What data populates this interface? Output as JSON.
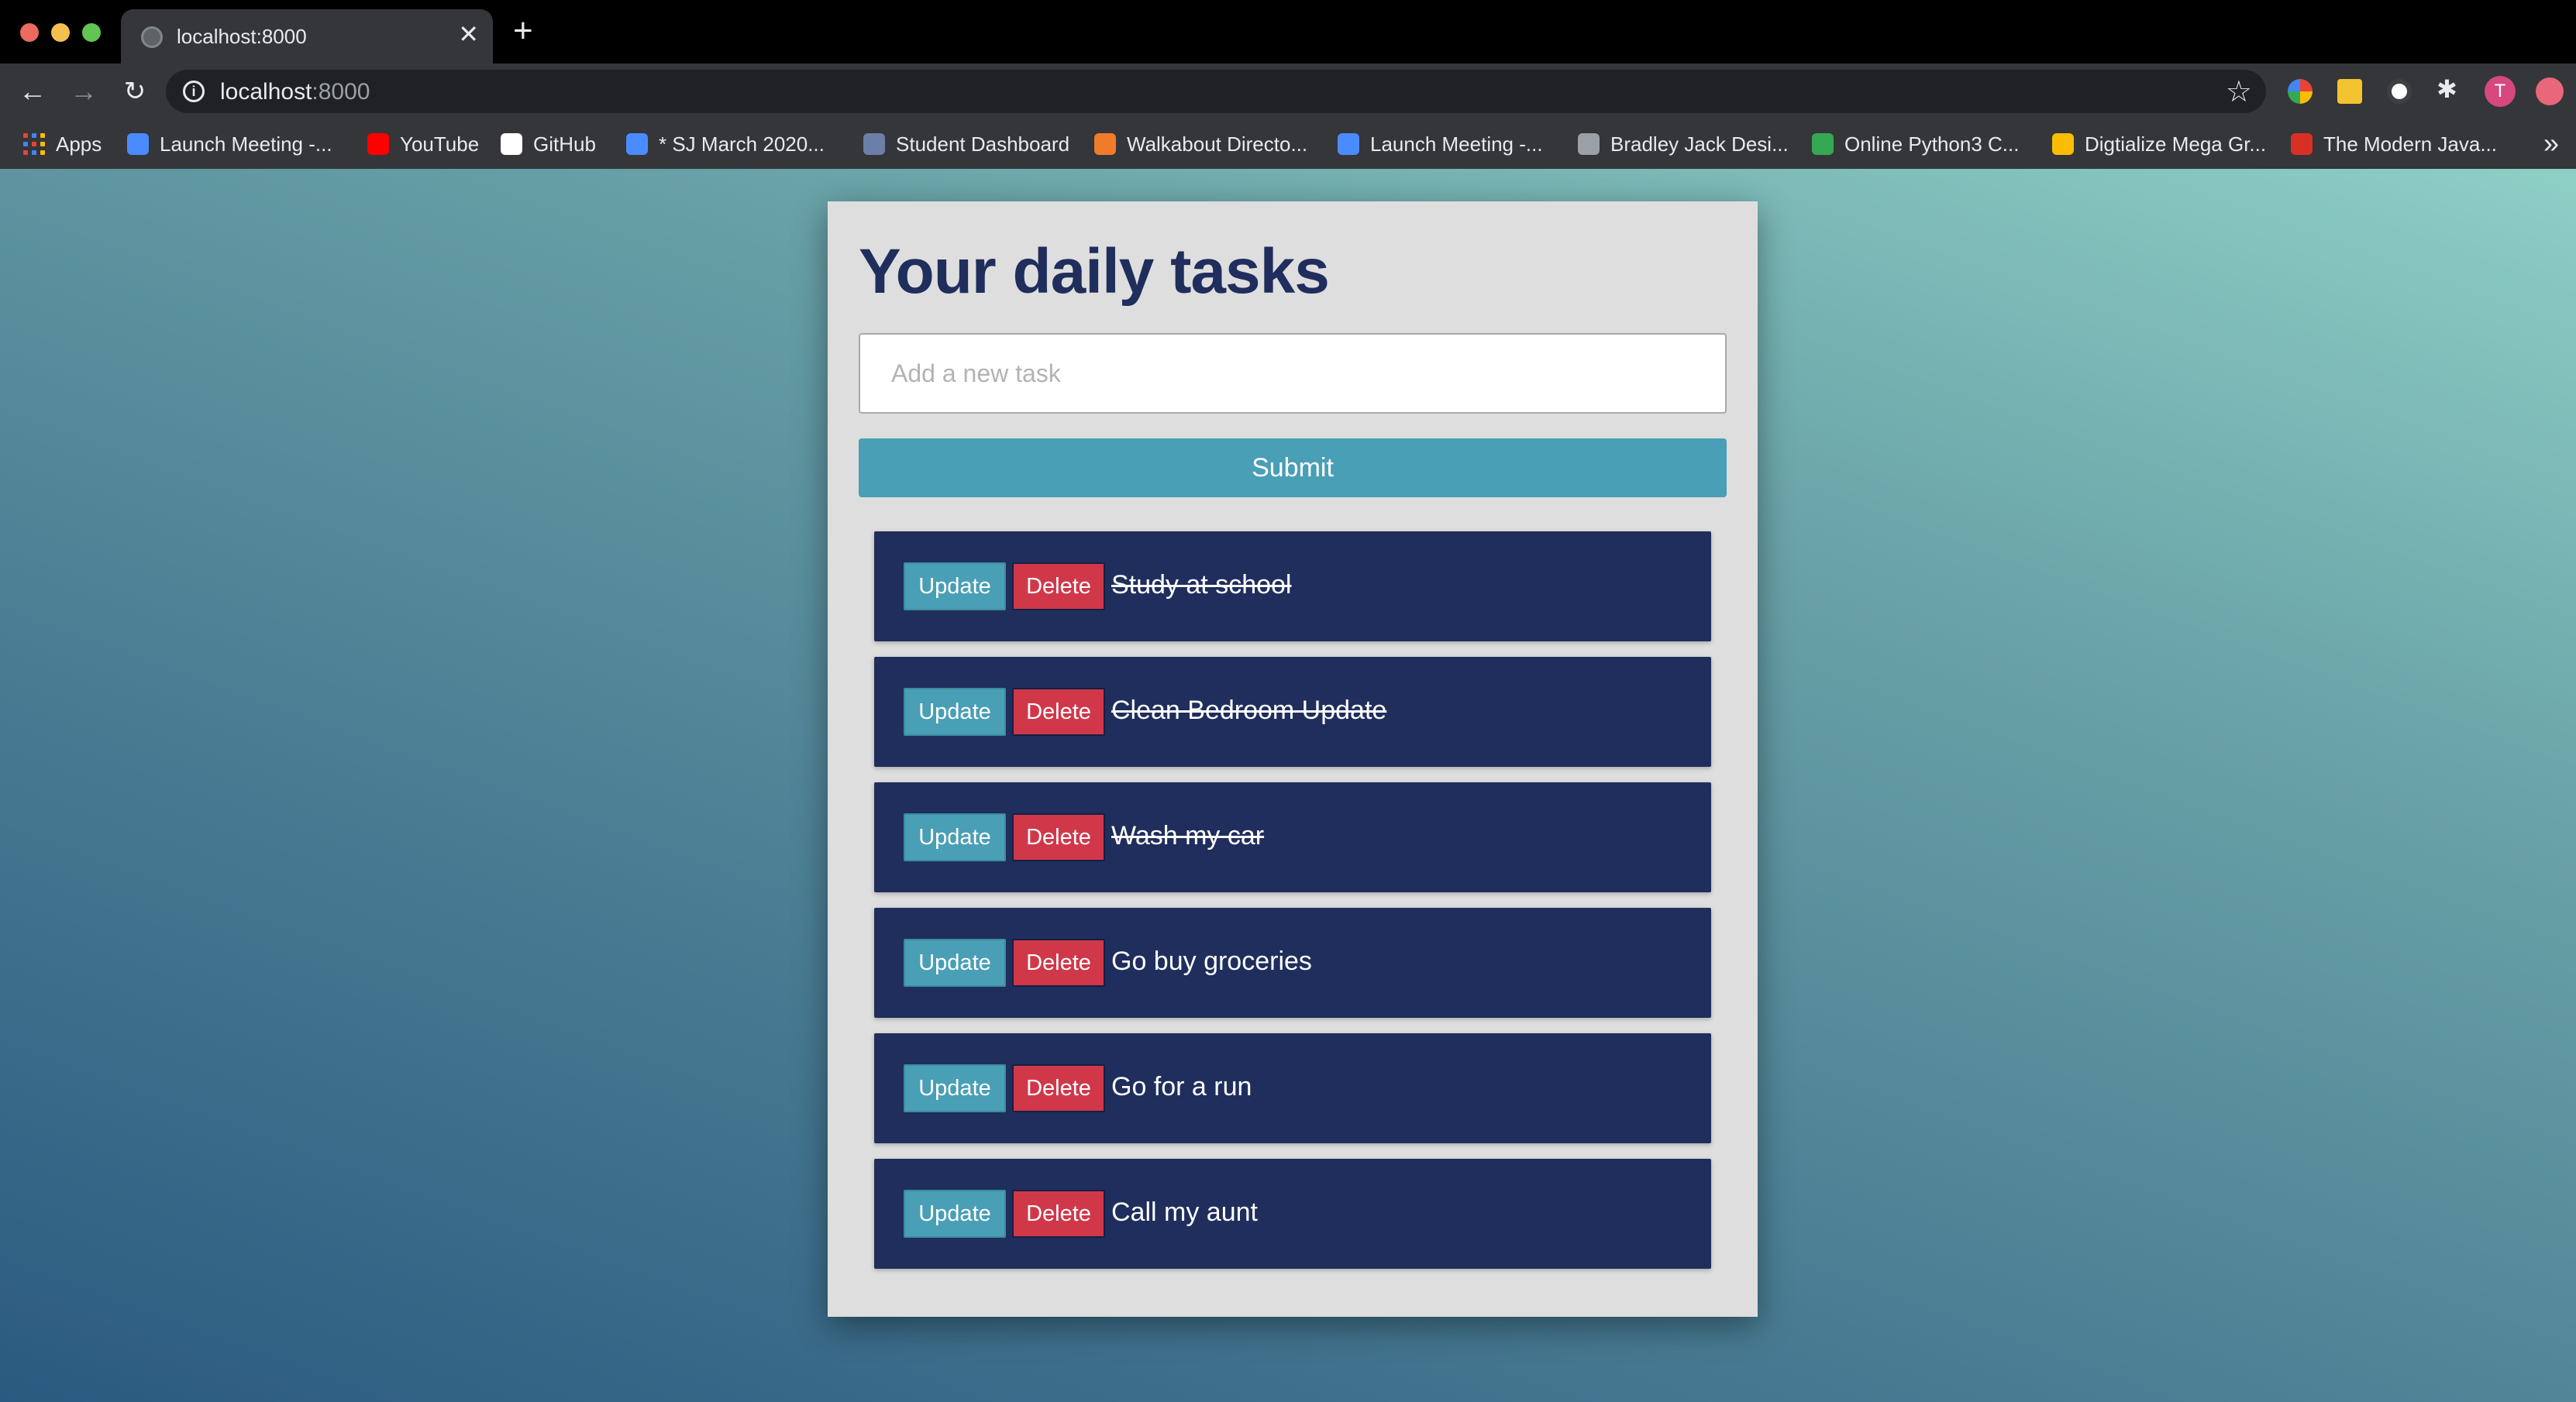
{
  "browser": {
    "tab_title": "localhost:8000",
    "new_tab_symbol": "+",
    "close_symbol": "✕",
    "url_host": "localhost",
    "url_port": ":8000",
    "avatar_initial": "T",
    "bookmarks": [
      {
        "label": "Apps",
        "icon": "apps-grid-icon",
        "color": "#ea4335"
      },
      {
        "label": "Launch Meeting -...",
        "icon": "zoom-icon",
        "color": "#4a8cff"
      },
      {
        "label": "YouTube",
        "icon": "youtube-icon",
        "color": "#ff0000"
      },
      {
        "label": "GitHub",
        "icon": "github-icon",
        "color": "#ffffff"
      },
      {
        "label": "* SJ March 2020...",
        "icon": "refresh-circle-icon",
        "color": "#4a8cff"
      },
      {
        "label": "Student Dashboard",
        "icon": "dashboard-icon",
        "color": "#6b7fa8"
      },
      {
        "label": "Walkabout Directo...",
        "icon": "walkabout-icon",
        "color": "#f07c2a"
      },
      {
        "label": "Launch Meeting -...",
        "icon": "zoom-icon",
        "color": "#4a8cff"
      },
      {
        "label": "Bradley Jack Desi...",
        "icon": "bradley-icon",
        "color": "#9aa0a6"
      },
      {
        "label": "Online Python3 C...",
        "icon": "code-icon",
        "color": "#34a853"
      },
      {
        "label": "Digtialize Mega Gr...",
        "icon": "google-drive-icon",
        "color": "#fbbc04"
      },
      {
        "label": "The Modern Java...",
        "icon": "javascript-icon",
        "color": "#d93025"
      }
    ]
  },
  "page": {
    "heading": "Your daily tasks",
    "input_placeholder": "Add a new task",
    "submit_label": "Submit",
    "update_label": "Update",
    "delete_label": "Delete",
    "tasks": [
      {
        "text": "Study at school",
        "completed": true
      },
      {
        "text": "Clean Bedroom Update",
        "completed": true
      },
      {
        "text": "Wash my car",
        "completed": true
      },
      {
        "text": "Go buy groceries",
        "completed": false
      },
      {
        "text": "Go for a run",
        "completed": false
      },
      {
        "text": "Call my aunt",
        "completed": false
      }
    ]
  },
  "colors": {
    "card_bg": "#dedede",
    "task_bg": "#1f2e5c",
    "update_btn": "#499fb5",
    "delete_btn": "#d0384a",
    "heading": "#1f2e5c"
  }
}
